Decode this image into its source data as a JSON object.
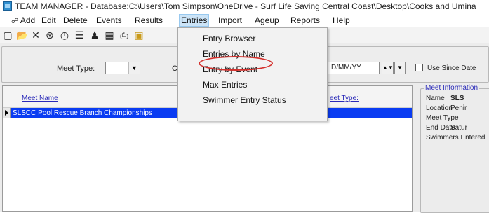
{
  "titlebar": {
    "title": "TEAM MANAGER - Database:C:\\Users\\Tom Simpson\\OneDrive - Surf Life Saving Central Coast\\Desktop\\Cooks and Umina"
  },
  "menubar": {
    "items": [
      "Add",
      "Edit",
      "Delete",
      "Events",
      "Results",
      "Entries",
      "Import",
      "Ageup",
      "Reports",
      "Help"
    ],
    "open_item": "Entries"
  },
  "toolbar": {
    "icons": [
      "new-document-icon",
      "open-folder-icon",
      "delete-x-icon",
      "team-icon",
      "clock-icon",
      "list-icon",
      "swimmer-icon",
      "calendar-icon",
      "print-icon",
      "folder-icon"
    ]
  },
  "filters": {
    "meet_type_label": "Meet Type:",
    "meet_type_value": "",
    "course_label_partial": "Co",
    "date_placeholder": "DD/MM/YY",
    "date_visible_text": "D/MM/YY",
    "use_since_date_label": "Use Since Date",
    "use_since_date_checked": false
  },
  "grid": {
    "columns": [
      "Meet Name",
      "eet Type:"
    ],
    "rows": [
      {
        "meet_name": "SLSCC Pool Rescue Branch Championships",
        "selected": true
      }
    ]
  },
  "meet_info": {
    "title": "Meet Information",
    "fields": [
      {
        "label": "Name",
        "value": "SLS"
      },
      {
        "label": "Location",
        "value": "Penir"
      },
      {
        "label": "Meet Type",
        "value": ""
      },
      {
        "label": "End Date",
        "value": "Satur"
      },
      {
        "label": "Swimmers Entered",
        "value": ""
      }
    ]
  },
  "entries_menu": {
    "items": [
      "Entry Browser",
      "Entries by Name",
      "Entry by Event",
      "Max Entries",
      "Swimmer Entry Status"
    ],
    "highlighted_item": "Entries by Name",
    "highlight_color": "#d4302c"
  },
  "colors": {
    "selection_row": "#0a3cf2",
    "link_text": "#2a2ab8",
    "menu_open_bg": "#cce4f7"
  }
}
